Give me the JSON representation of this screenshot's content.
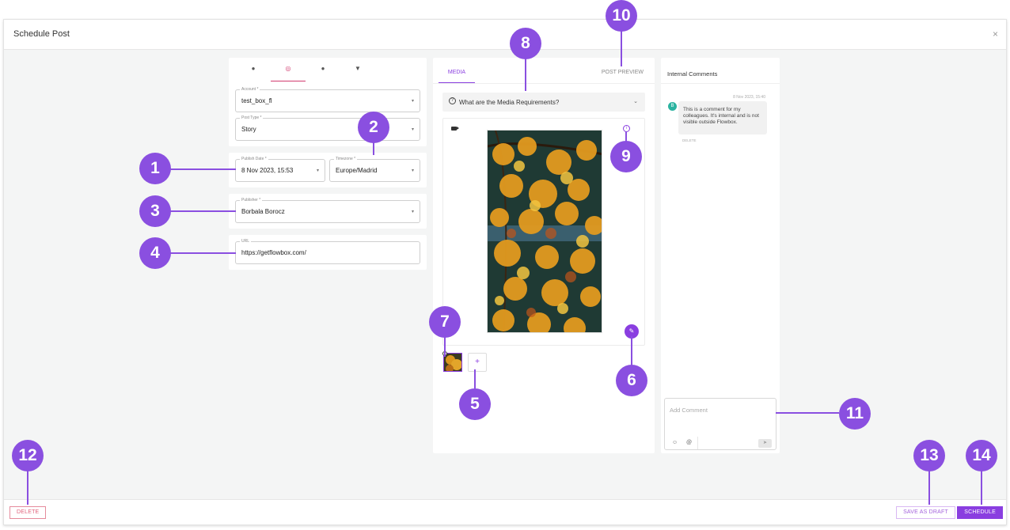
{
  "modal": {
    "title": "Schedule Post",
    "close_icon": "×"
  },
  "networks": [
    {
      "name": "facebook",
      "glyph": "●"
    },
    {
      "name": "instagram",
      "glyph": "◎"
    },
    {
      "name": "pinterest",
      "glyph": "●"
    },
    {
      "name": "twitter",
      "glyph": "▼"
    }
  ],
  "account": {
    "label": "Account *",
    "value": "test_box_fl"
  },
  "post_type": {
    "label": "Post Type *",
    "value": "Story"
  },
  "publish_date": {
    "label": "Publish Date *",
    "value": "8 Nov 2023, 15:53"
  },
  "timezone": {
    "label": "Timezone *",
    "value": "Europe/Madrid"
  },
  "publisher": {
    "label": "Publisher *",
    "value": "Borbala Borocz"
  },
  "url": {
    "label": "URL",
    "value": "https://getflowbox.com/"
  },
  "dropdown_arrow": "▾",
  "media": {
    "tab_media": "MEDIA",
    "tab_preview": "POST PREVIEW",
    "requirements": "What are the Media Requirements?",
    "requirements_icon": "?",
    "chevron": "⌄",
    "info_icon": "i",
    "edit_icon": "✎",
    "remove_icon": "×",
    "add_label": "+"
  },
  "comments": {
    "title": "Internal Comments",
    "items": [
      {
        "avatar": "B",
        "time": "8 Nov 2023, 15:40",
        "text": "This is a comment for my colleagues. It's internal and is not visible outside Flowbox.",
        "delete": "DELETE"
      }
    ],
    "input_placeholder": "Add Comment",
    "emoji_icon": "☺",
    "mention_icon": "@",
    "send_icon": "➤"
  },
  "footer": {
    "delete": "DELETE",
    "save_draft": "SAVE AS DRAFT",
    "schedule": "SCHEDULE"
  },
  "badges": [
    "1",
    "2",
    "3",
    "4",
    "5",
    "6",
    "7",
    "8",
    "9",
    "10",
    "11",
    "12",
    "13",
    "14"
  ],
  "colors": {
    "accent": "#8a3ee0",
    "badge": "#8a4fe0",
    "instagram": "#d13b6f",
    "avatar": "#2bb3a0"
  }
}
